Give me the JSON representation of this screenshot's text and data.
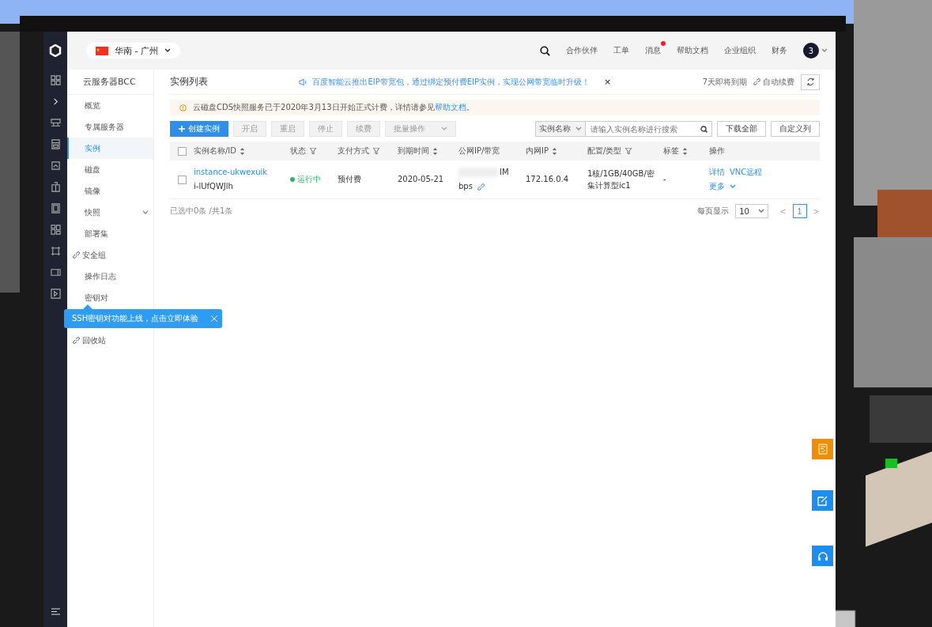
{
  "topbar": {
    "region": "华南 - 广州",
    "nav": [
      {
        "label": "合作伙伴",
        "badge": false
      },
      {
        "label": "工单",
        "badge": false
      },
      {
        "label": "消息",
        "badge": true
      },
      {
        "label": "帮助文档",
        "badge": false
      },
      {
        "label": "企业组织",
        "badge": false
      },
      {
        "label": "财务",
        "badge": false
      }
    ],
    "avatar": "3"
  },
  "sidebar": {
    "title": "云服务器BCC",
    "items": [
      {
        "label": "概览",
        "selected": false,
        "kind": "plain"
      },
      {
        "label": "专属服务器",
        "selected": false,
        "kind": "plain"
      },
      {
        "label": "实例",
        "selected": true,
        "kind": "plain"
      },
      {
        "label": "磁盘",
        "selected": false,
        "kind": "plain"
      },
      {
        "label": "镜像",
        "selected": false,
        "kind": "plain"
      },
      {
        "label": "快照",
        "selected": false,
        "kind": "expand"
      },
      {
        "label": "部署集",
        "selected": false,
        "kind": "plain"
      },
      {
        "label": "安全组",
        "selected": false,
        "kind": "link"
      },
      {
        "label": "操作日志",
        "selected": false,
        "kind": "plain"
      },
      {
        "label": "密钥对",
        "selected": false,
        "kind": "plain"
      }
    ],
    "bottom_items": [
      {
        "label": "回收站",
        "selected": false,
        "kind": "link"
      }
    ]
  },
  "tooltip": {
    "text": "SSH密钥对功能上线，点击立即体验"
  },
  "page": {
    "title": "实例列表",
    "notice": "百度智能云推出EIP带宽包，通过绑定预付费EIP实例，实现公网带宽临时升级！",
    "notice_close": "×",
    "expiring": "7天即将到期",
    "auto_renew": "自动续费"
  },
  "alert": {
    "text": "云磁盘CDS快照服务已于2020年3月13日开始正式计费，详情请参见",
    "link": "帮助文档",
    "end": "。"
  },
  "toolbar": {
    "create": "创建实例",
    "buttons": [
      {
        "label": "开启",
        "disabled": true
      },
      {
        "label": "重启",
        "disabled": true
      },
      {
        "label": "停止",
        "disabled": true
      },
      {
        "label": "续费",
        "disabled": true
      }
    ],
    "batch": "批量操作",
    "search_scope": "实例名称",
    "search_placeholder": "请输入实例名称进行搜索",
    "download": "下载全部",
    "customize": "自定义列"
  },
  "table": {
    "all_checked": false,
    "columns": [
      {
        "label": "实例名称/ID",
        "kind": "sortable"
      },
      {
        "label": "状态",
        "kind": "filterable"
      },
      {
        "label": "支付方式",
        "kind": "filterable"
      },
      {
        "label": "到期时间",
        "kind": "sortable"
      },
      {
        "label": "公网IP/带宽",
        "kind": "plain"
      },
      {
        "label": "内网IP",
        "kind": "sortable"
      },
      {
        "label": "配置/类型",
        "kind": "filterable"
      },
      {
        "label": "标签",
        "kind": "sortable"
      },
      {
        "label": "操作",
        "kind": "plain"
      }
    ],
    "rows": [
      {
        "checked": false,
        "name": "instance-ukwexuik",
        "id": "i-lUfQWJlh",
        "status": "运行中",
        "color": "#2ab673",
        "pay": "预付费",
        "expire": "2020-05-21",
        "public_ip": "IM",
        "bandwidth": "bps",
        "private_ip": "172.16.0.4",
        "config": "1核/1GB/40GB/密集计算型ic1",
        "tag": "-",
        "actions": [
          "详情",
          "VNC远程",
          "更多"
        ]
      }
    ]
  },
  "footer": {
    "selection": "已选中0条 /共1条",
    "per_page_label": "每页显示",
    "per_page": "10",
    "prev": "<",
    "next": ">",
    "pages": [
      {
        "label": "1",
        "selected": true
      }
    ]
  }
}
